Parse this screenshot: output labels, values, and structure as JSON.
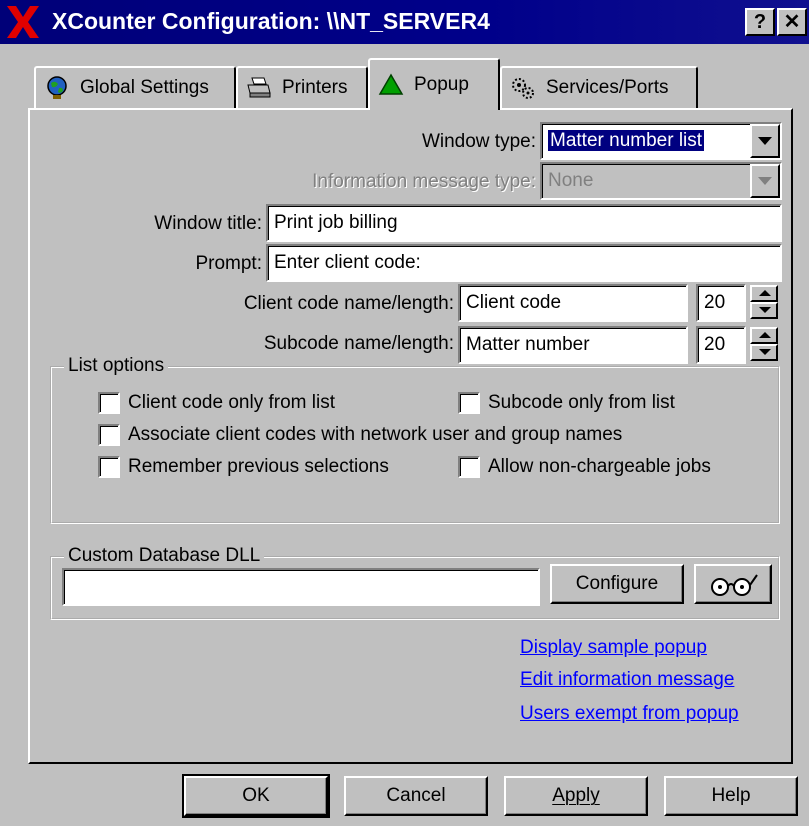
{
  "window": {
    "title": "XCounter Configuration: \\\\NT_SERVER4",
    "help_button": "?",
    "close_button": "✕"
  },
  "tabs": [
    {
      "label": "Global Settings",
      "icon": "globe-icon"
    },
    {
      "label": "Printers",
      "icon": "printer-icon"
    },
    {
      "label": "Popup",
      "icon": "triangle-icon",
      "active": true
    },
    {
      "label": "Services/Ports",
      "icon": "gears-icon"
    }
  ],
  "popup": {
    "window_type": {
      "label": "Window type:",
      "value": "Matter number list"
    },
    "info_message_type": {
      "label": "Information message type:",
      "value": "None",
      "disabled": true
    },
    "window_title": {
      "label": "Window title:",
      "value": "Print job billing"
    },
    "prompt": {
      "label": "Prompt:",
      "value": "Enter client code:"
    },
    "client_code": {
      "label": "Client code name/length:",
      "name": "Client code",
      "length": "20"
    },
    "subcode": {
      "label": "Subcode name/length:",
      "name": "Matter number",
      "length": "20"
    }
  },
  "list_options": {
    "title": "List options",
    "client_code_only": "Client code only from list",
    "subcode_only": "Subcode only from list",
    "associate": "Associate client codes with network user and group names",
    "remember": "Remember previous selections",
    "allow_nonchargeable": "Allow non-chargeable jobs"
  },
  "custom_dll": {
    "title": "Custom Database DLL",
    "value": "",
    "configure": "Configure",
    "browse_icon": "glasses-icon"
  },
  "links": {
    "display_sample": "Display sample popup",
    "edit_info": "Edit information message",
    "users_exempt": "Users exempt from popup"
  },
  "buttons": {
    "ok": "OK",
    "cancel": "Cancel",
    "apply": "Apply",
    "help": "Help"
  },
  "colors": {
    "titlebar": "#000080",
    "face": "#c0c0c0",
    "link": "#0000ff"
  }
}
